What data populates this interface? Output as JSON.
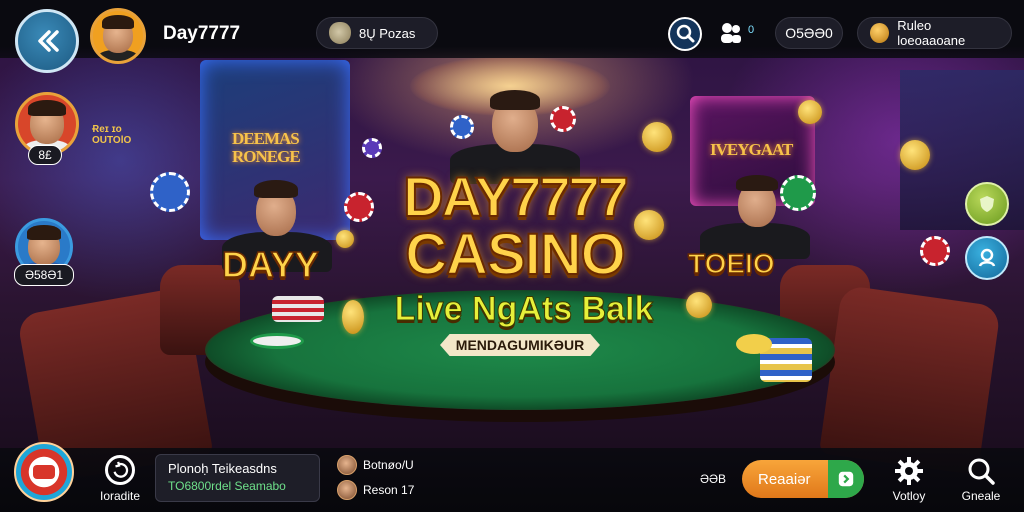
{
  "header": {
    "username": "Day7777",
    "bonus_label": "8Ų Pozas",
    "icon_badge": "0",
    "coins": "O5ƏƏ0",
    "rules_label": "Ruleo loeoaaoane"
  },
  "left_panel": {
    "player1_tag": "8£",
    "player1_note_line1": "Ɍeɪ ɪo",
    "player1_note_line2": "OUTOlO",
    "player2_tag": "Ə58Ə1"
  },
  "scene": {
    "logo_line1": "DAY7777",
    "logo_line2": "CASINO",
    "subtitle": "Live NgAts BaIk",
    "banner": "MENDAGUMIKƏUR",
    "left_word": "DAYY",
    "right_word": "TOEIO",
    "left_sign": "DEEMAS RONEGE",
    "right_sign": "IVEYGAAT"
  },
  "bottom": {
    "readme_label": "Ioradite",
    "chat_title": "Plonoḥ Teikeasdns",
    "chat_sub": "TO6800rdel Seamabo",
    "player1_name": "Botnøo/U",
    "player2_name": "Reson 17",
    "bet_prefix": "ƏƏB",
    "bet_button": "Reaaiər",
    "verify_label": "Votloy",
    "search_label": "Gneale"
  },
  "colors": {
    "accent_gold": "#ffd34a",
    "bet_orange": "#f08a26",
    "go_green": "#2ea84a",
    "chat_green": "#6ee08a"
  }
}
